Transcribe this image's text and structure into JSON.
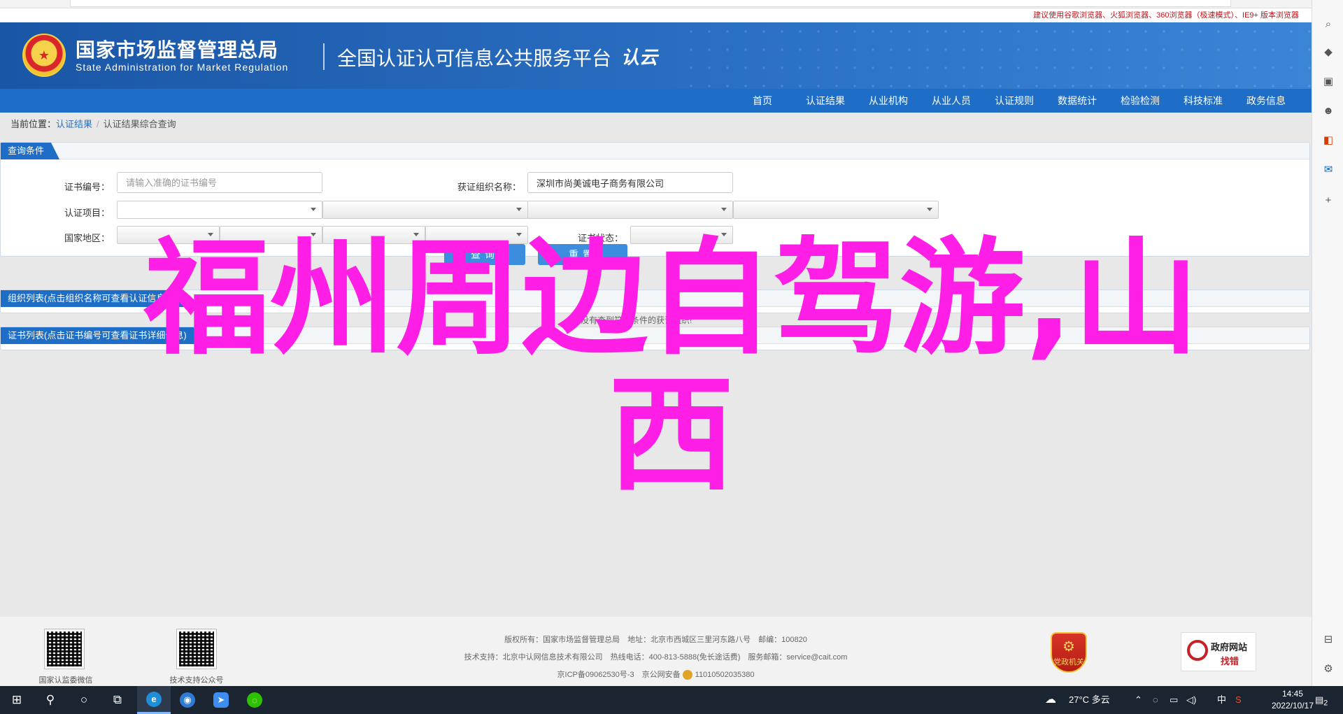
{
  "top_notice": "建议使用谷歌浏览器、火狐浏览器、360浏览器（极速模式）、IE9+ 版本浏览器",
  "header": {
    "agency_cn": "国家市场监督管理总局",
    "agency_en": "State Administration for Market Regulation",
    "platform_title": "全国认证认可信息公共服务平台",
    "platform_logo": "认云"
  },
  "nav": [
    "首页",
    "认证结果",
    "从业机构",
    "从业人员",
    "认证规则",
    "数据统计",
    "检验检测",
    "科技标准",
    "政务信息"
  ],
  "breadcrumb": {
    "prefix": "当前位置：",
    "link": "认证结果",
    "separator": "/",
    "current": "认证结果综合查询"
  },
  "query": {
    "tab": "查询条件",
    "cert_no_label": "证书编号：",
    "cert_no_placeholder": "请输入准确的证书编号",
    "org_label": "获证组织名称：",
    "org_value": "深圳市尚美诚电子商务有限公司",
    "project_label": "认证项目：",
    "region_label": "国家地区：",
    "status_label": "证书状态：",
    "search_btn": "查询",
    "reset_btn": "重置"
  },
  "org_list": {
    "tab": "组织列表(点击组织名称可查看认证信息)"
  },
  "no_result": "没有查到符合条件的获证组织!",
  "cert_list": {
    "tab": "证书列表(点击证书编号可查看证书详细信息)"
  },
  "overlay": {
    "line1": "福州周边自驾游,山",
    "line2": "西"
  },
  "footer": {
    "qr1_label": "国家认监委微信",
    "qr2_label": "技术支持公众号",
    "line1": "版权所有：国家市场监督管理总局　地址：北京市西城区三里河东路八号　邮编：100820",
    "line2": "技术支持：北京中认网信息技术有限公司　热线电话：400-813-5888(免长途话费)　服务邮箱：service@cait.com",
    "icp": "京ICP备09062530号-3　京公网安备",
    "police_no": "11010502035380",
    "party_badge": "党政机关",
    "gov_badge_t1": "政府网站",
    "gov_badge_t2": "找错"
  },
  "taskbar": {
    "weather": "27°C 多云",
    "ime": "中",
    "time": "14:45",
    "date": "2022/10/17",
    "notification_count": "2"
  }
}
